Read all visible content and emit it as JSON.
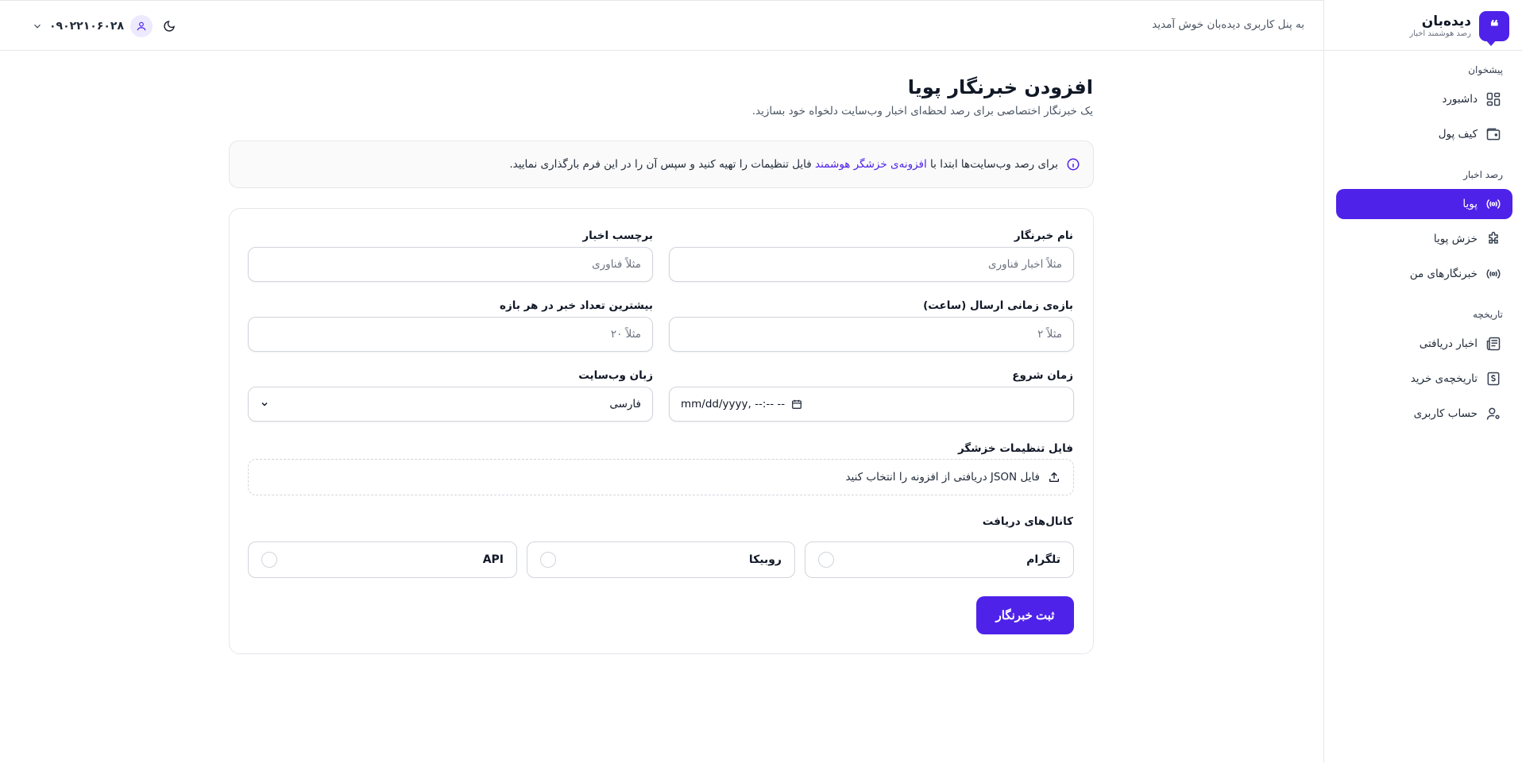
{
  "brand": {
    "name": "دیده‌بان",
    "tagline": "رصد هوشمند اخبار",
    "logo_glyph": "❝"
  },
  "header": {
    "welcome": "به پنل کاربری دیده‌بان خوش آمدید",
    "phone": "۰۹۰۲۲۱۰۶۰۲۸"
  },
  "sidebar": {
    "sections": [
      {
        "title": "پیشخوان",
        "items": [
          {
            "label": "داشبورد",
            "icon": "dashboard-icon"
          },
          {
            "label": "کیف پول",
            "icon": "wallet-icon"
          }
        ]
      },
      {
        "title": "رصد اخبار",
        "items": [
          {
            "label": "پویا",
            "icon": "broadcast-icon",
            "active": true
          },
          {
            "label": "خزش پویا",
            "icon": "puzzle-icon"
          },
          {
            "label": "خبرنگارهای من",
            "icon": "broadcast-icon"
          }
        ]
      },
      {
        "title": "تاریخچه",
        "items": [
          {
            "label": "اخبار دریافتی",
            "icon": "newspaper-icon"
          },
          {
            "label": "تاریخچه‌ی خرید",
            "icon": "receipt-icon"
          },
          {
            "label": "حساب کاربری",
            "icon": "user-gear-icon"
          }
        ]
      }
    ]
  },
  "page": {
    "title": "افزودن خبرنگار پویا",
    "subtitle": "یک خبرنگار اختصاصی برای رصد لحظه‌ای اخبار وب‌سایت دلخواه خود بسازید."
  },
  "notice": {
    "before": "برای رصد وب‌سایت‌ها ابتدا با",
    "link": "افزونه‌ی خزشگر هوشمند",
    "after": "فایل تنظیمات را تهیه کنید و سپس آن را در این فرم بارگذاری نمایید."
  },
  "form": {
    "reporter_name": {
      "label": "نام خبرنگار",
      "placeholder": "مثلاً اخبار فناوری"
    },
    "news_tag": {
      "label": "برچسب اخبار",
      "placeholder": "مثلاً فناوری"
    },
    "send_interval": {
      "label": "بازه‌ی زمانی ارسال (ساعت)",
      "placeholder": "مثلاً ۲"
    },
    "max_news": {
      "label": "بیشترین تعداد خبر در هر بازه",
      "placeholder": "مثلاً ۲۰"
    },
    "start_time": {
      "label": "زمان شروع",
      "value": "mm/dd/yyyy, --:-- --"
    },
    "site_language": {
      "label": "زبان وب‌سایت",
      "value": "فارسی"
    },
    "crawler_file": {
      "label": "فایل تنظیمات خزشگر",
      "text": "فایل JSON دریافتی از افزونه را انتخاب کنید"
    },
    "channels": {
      "label": "کانال‌های دریافت",
      "options": [
        "تلگرام",
        "روبیکا",
        "API"
      ]
    },
    "submit_label": "ثبت خبرنگار"
  },
  "colors": {
    "accent": "#4f22e9"
  }
}
